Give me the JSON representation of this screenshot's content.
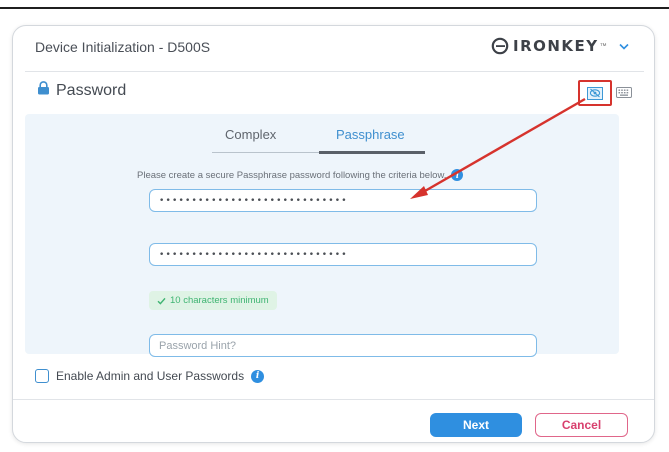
{
  "window": {
    "title": "Device Initialization - D500S"
  },
  "brand": {
    "name": "IRONKEY",
    "tm": "™"
  },
  "section": {
    "title": "Password"
  },
  "tabs": [
    {
      "label": "Complex",
      "active": false
    },
    {
      "label": "Passphrase",
      "active": true
    }
  ],
  "form": {
    "instruction": "Please create a secure Passphrase password following the criteria below.",
    "password_value": "•••••••••••••••••••••••••••••",
    "confirm_value": "•••••••••••••••••••••••••••••",
    "requirement": "10 characters minimum",
    "hint_placeholder": "Password Hint?"
  },
  "options": {
    "enable_admin_label": "Enable Admin and User Passwords",
    "enable_admin_checked": false
  },
  "buttons": {
    "next": "Next",
    "cancel": "Cancel"
  },
  "icons": {
    "lock": "lock-icon",
    "show_password": "eye-slash-icon",
    "keyboard": "keyboard-icon",
    "chevron": "chevron-down-icon",
    "info": "info-icon",
    "check": "check-icon"
  },
  "colors": {
    "accent": "#2f8fe0",
    "cancel": "#d8406e",
    "success": "#3fb472",
    "annotation": "#d6332d",
    "panel_bg": "#eef5fb"
  }
}
